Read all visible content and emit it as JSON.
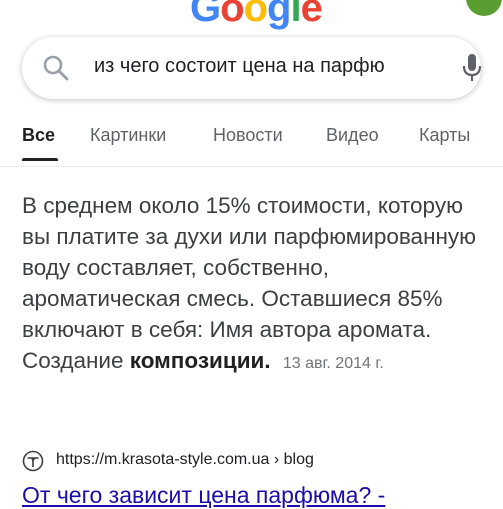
{
  "logo": {
    "text": "Google",
    "letters": [
      "G",
      "o",
      "o",
      "g",
      "l",
      "e"
    ]
  },
  "search": {
    "query": "из чего состоит цена на парфю"
  },
  "tabs": [
    {
      "label": "Все",
      "active": true
    },
    {
      "label": "Картинки"
    },
    {
      "label": "Новости"
    },
    {
      "label": "Видео"
    },
    {
      "label": "Карты"
    }
  ],
  "snippet": {
    "text": "В среднем около 15% стоимости, которую вы платите за духи или парфюмированную воду составляет, собственно, ароматическая смесь. Оставшиеся 85% включают в себя: Имя автора аромата. Создание",
    "bold_text": "композиции.",
    "date": "13 авг. 2014 г."
  },
  "source": {
    "url": "https://m.krasota-style.com.ua",
    "path": " › blog"
  },
  "result": {
    "title": "От чего зависит цена парфюма? -"
  },
  "colors": {
    "link": "#1a0dab",
    "text": "#202124",
    "muted": "#70757a",
    "avatar": "#5a9e32"
  },
  "icons": [
    "search-icon",
    "mic-icon",
    "site-favicon"
  ]
}
